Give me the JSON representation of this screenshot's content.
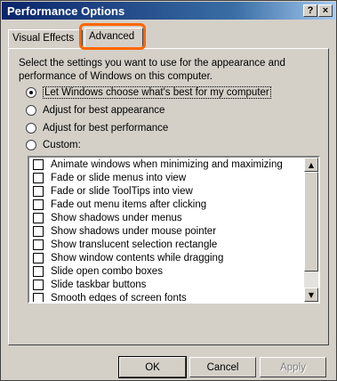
{
  "window": {
    "title": "Performance Options",
    "help_label": "?",
    "close_label": "×"
  },
  "tabs": [
    {
      "label": "Visual Effects",
      "selected": false
    },
    {
      "label": "Advanced",
      "selected": true
    }
  ],
  "highlight_color": "#ff6600",
  "description": "Select the settings you want to use for the appearance and performance of Windows on this computer.",
  "radios": [
    {
      "label": "Let Windows choose what's best for my computer",
      "checked": true
    },
    {
      "label": "Adjust for best appearance",
      "checked": false
    },
    {
      "label": "Adjust for best performance",
      "checked": false
    },
    {
      "label": "Custom:",
      "checked": false
    }
  ],
  "effects": [
    "Animate windows when minimizing and maximizing",
    "Fade or slide menus into view",
    "Fade or slide ToolTips into view",
    "Fade out menu items after clicking",
    "Show shadows under menus",
    "Show shadows under mouse pointer",
    "Show translucent selection rectangle",
    "Show window contents while dragging",
    "Slide open combo boxes",
    "Slide taskbar buttons",
    "Smooth edges of screen fonts"
  ],
  "buttons": {
    "ok": "OK",
    "cancel": "Cancel",
    "apply": "Apply"
  }
}
